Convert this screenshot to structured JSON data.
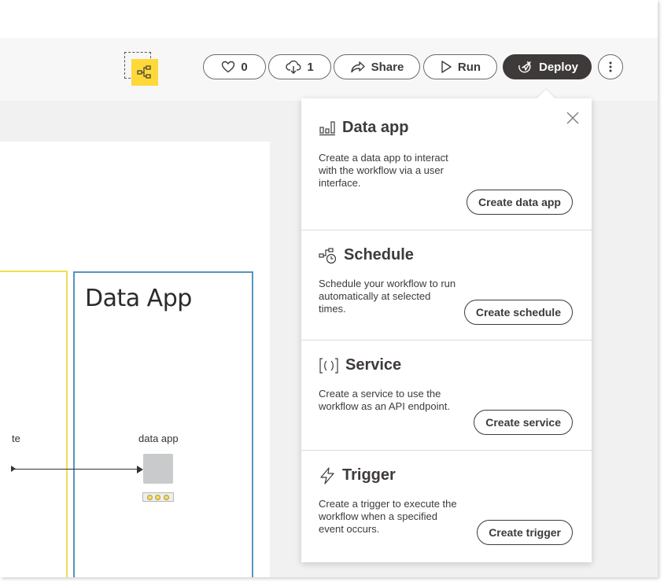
{
  "canvas": {
    "annotation_title": "Data App",
    "node_label": "data app",
    "left_node_label": "te"
  },
  "toolbar": {
    "likes_count": "0",
    "downloads_count": "1",
    "share_label": "Share",
    "run_label": "Run",
    "deploy_label": "Deploy",
    "icons": [
      "workflow-icon",
      "heart-icon",
      "cloud-download-icon",
      "share-icon",
      "play-icon",
      "deploy-icon",
      "more-vertical-icon"
    ]
  },
  "deploy_menu": {
    "sections": [
      {
        "title": "Data app",
        "icon": "data-app-icon",
        "description": "Create a data app to interact with the workflow via a user interface.",
        "button": "Create data app"
      },
      {
        "title": "Schedule",
        "icon": "schedule-icon",
        "description": "Schedule your workflow to run automatically at selected times.",
        "button": "Create schedule"
      },
      {
        "title": "Service",
        "icon": "service-icon",
        "description": "Create a service to use the workflow as an API endpoint.",
        "button": "Create service"
      },
      {
        "title": "Trigger",
        "icon": "trigger-icon",
        "description": "Create a trigger to execute the workflow when a specified event occurs.",
        "button": "Create trigger"
      }
    ]
  },
  "colors": {
    "selection": "#ffd83a",
    "annotation_yellow": "#f5dd4f",
    "annotation_blue": "#5894b9",
    "deploy_button": "#3e3a39"
  }
}
